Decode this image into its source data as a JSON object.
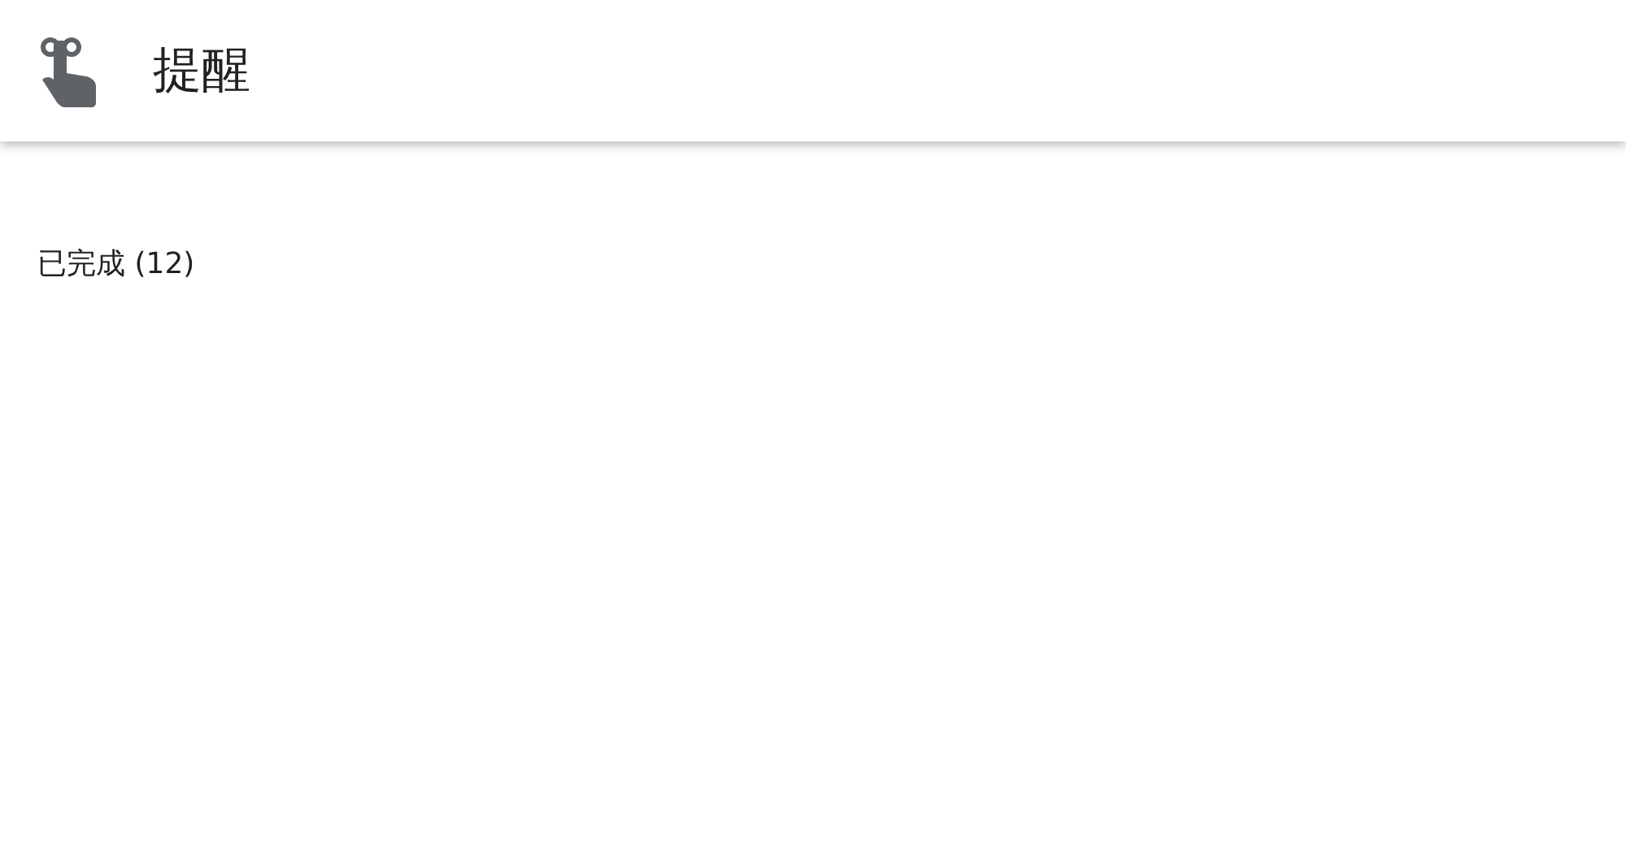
{
  "header": {
    "title": "提醒"
  },
  "section": {
    "heading": "已完成 (12)"
  }
}
